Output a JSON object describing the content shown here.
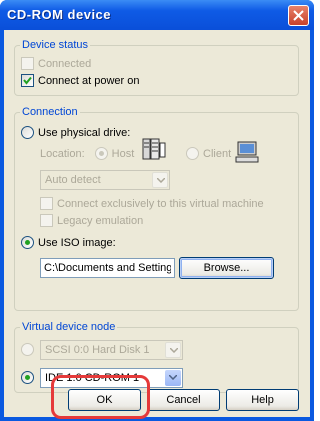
{
  "window": {
    "title": "CD-ROM device"
  },
  "device_status": {
    "legend": "Device status",
    "connected_label": "Connected",
    "connected_checked": false,
    "connect_power_label": "Connect at power on",
    "connect_power_checked": true
  },
  "connection": {
    "legend": "Connection",
    "physical_label": "Use physical drive:",
    "location_label": "Location:",
    "host_label": "Host",
    "client_label": "Client",
    "drive_value": "Auto detect",
    "exclusive_label": "Connect exclusively to this virtual machine",
    "legacy_label": "Legacy emulation",
    "iso_label": "Use ISO image:",
    "iso_path": "C:\\Documents and Settings\\USER",
    "browse_label": "Browse..."
  },
  "virtual_node": {
    "legend": "Virtual device node",
    "scsi_value": "SCSI 0:0   Hard Disk 1",
    "ide_value": "IDE 1:0   CD-ROM 1"
  },
  "buttons": {
    "ok": "OK",
    "cancel": "Cancel",
    "help": "Help"
  },
  "colors": {
    "title_bar": "#0a4fd9",
    "dialog_bg": "#ece9d8",
    "legend_text": "#0046d5",
    "highlight": "#e53a3a"
  }
}
